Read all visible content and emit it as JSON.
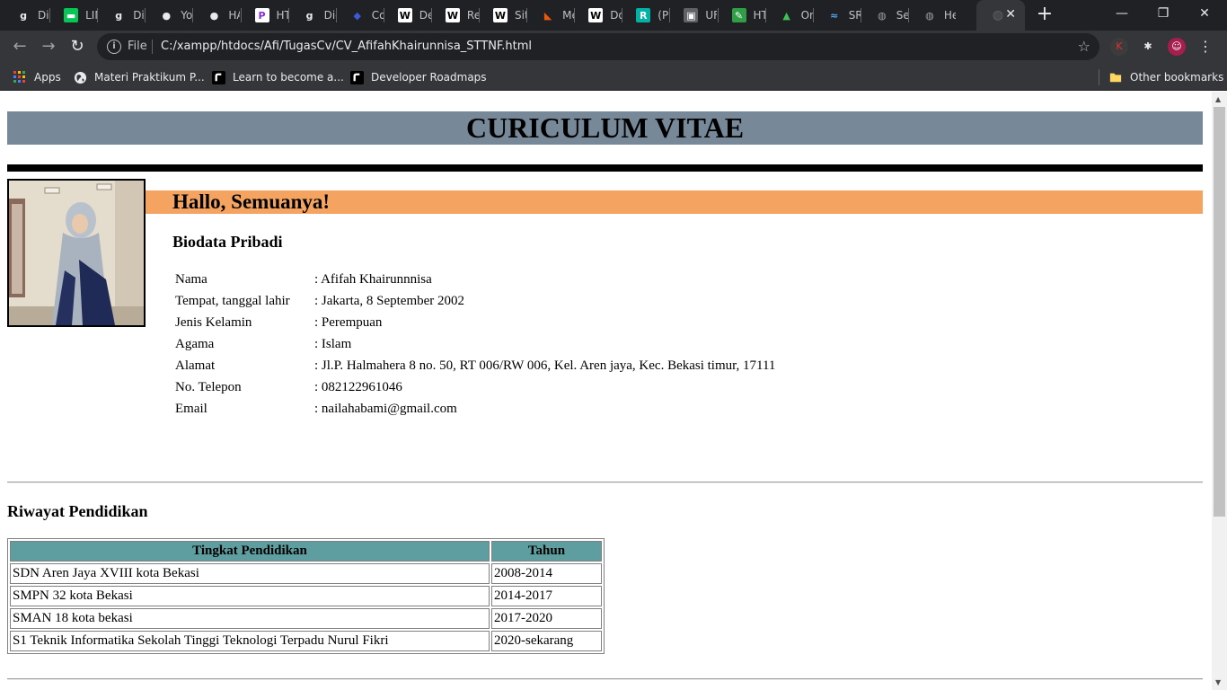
{
  "browser": {
    "tabs": [
      {
        "title": "Dic",
        "icon": "letter-g-icon",
        "icon_glyph": "g",
        "icon_color": "#e8eaed",
        "icon_bg": "transparent"
      },
      {
        "title": "LIN",
        "icon": "line-icon",
        "icon_glyph": "▬",
        "icon_color": "#ffffff",
        "icon_bg": "#06c755"
      },
      {
        "title": "Dic",
        "icon": "letter-g-icon",
        "icon_glyph": "g",
        "icon_color": "#e8eaed",
        "icon_bg": "transparent"
      },
      {
        "title": "Yo",
        "icon": "github-icon",
        "icon_glyph": "●",
        "icon_color": "#e8eaed",
        "icon_bg": "transparent"
      },
      {
        "title": "HA",
        "icon": "github-icon",
        "icon_glyph": "●",
        "icon_color": "#e8eaed",
        "icon_bg": "transparent"
      },
      {
        "title": "HT",
        "icon": "p-logo-icon",
        "icon_glyph": "P",
        "icon_color": "#8a2be2",
        "icon_bg": "#ffffff"
      },
      {
        "title": "Dic",
        "icon": "letter-g-icon",
        "icon_glyph": "g",
        "icon_color": "#e8eaed",
        "icon_bg": "transparent"
      },
      {
        "title": "Co",
        "icon": "blue-blob-icon",
        "icon_glyph": "◆",
        "icon_color": "#3b5bdb",
        "icon_bg": "transparent"
      },
      {
        "title": "De",
        "icon": "wikipedia-icon",
        "icon_glyph": "W",
        "icon_color": "#000000",
        "icon_bg": "#ffffff"
      },
      {
        "title": "Re",
        "icon": "wikipedia-icon",
        "icon_glyph": "W",
        "icon_color": "#000000",
        "icon_bg": "#ffffff"
      },
      {
        "title": "Sit",
        "icon": "wikipedia-icon",
        "icon_glyph": "W",
        "icon_color": "#000000",
        "icon_bg": "#ffffff"
      },
      {
        "title": "Me",
        "icon": "red-flag-icon",
        "icon_glyph": "◣",
        "icon_color": "#e8590c",
        "icon_bg": "transparent"
      },
      {
        "title": "Do",
        "icon": "wikipedia-icon",
        "icon_glyph": "W",
        "icon_color": "#000000",
        "icon_bg": "#ffffff"
      },
      {
        "title": "(PI",
        "icon": "r-logo-icon",
        "icon_glyph": "R",
        "icon_color": "#ffffff",
        "icon_bg": "#00b3a4"
      },
      {
        "title": "UF",
        "icon": "store-icon",
        "icon_glyph": "▣",
        "icon_color": "#ffffff",
        "icon_bg": "#5f6368"
      },
      {
        "title": "HT",
        "icon": "code-icon",
        "icon_glyph": "✎",
        "icon_color": "#ffffff",
        "icon_bg": "#2f9e44"
      },
      {
        "title": "Or",
        "icon": "green-mark-icon",
        "icon_glyph": "▲",
        "icon_color": "#40c057",
        "icon_bg": "transparent"
      },
      {
        "title": "SR",
        "icon": "wave-icon",
        "icon_glyph": "≈",
        "icon_color": "#4dabf7",
        "icon_bg": "transparent"
      },
      {
        "title": "Sel",
        "icon": "globe-icon",
        "icon_glyph": "◍",
        "icon_color": "#9aa0a6",
        "icon_bg": "transparent"
      },
      {
        "title": "He",
        "icon": "globe-icon",
        "icon_glyph": "◍",
        "icon_color": "#9aa0a6",
        "icon_bg": "transparent"
      }
    ],
    "active_tab": {
      "title": "",
      "icon": "globe-icon",
      "close": "✕"
    },
    "new_tab": "+",
    "window_controls": {
      "minimize": "—",
      "restore": "❐",
      "close": "✕"
    },
    "omnibox": {
      "scheme_label": "File",
      "url": "C:/xampp/htdocs/Afi/TugasCv/CV_AfifahKhairunnisa_STTNF.html"
    },
    "extensions": [
      {
        "icon": "k-extension-icon",
        "glyph": "K",
        "color": "#e03131",
        "bg": "#3c3c3c"
      },
      {
        "icon": "puzzle-icon",
        "glyph": "✱",
        "color": "#e8eaed",
        "bg": "transparent"
      },
      {
        "icon": "profile-avatar-icon",
        "glyph": "☺",
        "color": "#ffffff",
        "bg": "#a61e4d"
      },
      {
        "icon": "kebab-menu-icon",
        "glyph": "⋮",
        "color": "#e8eaed",
        "bg": "transparent"
      }
    ],
    "bookmarks": [
      {
        "label": "Apps",
        "icon": "apps-grid-icon"
      },
      {
        "label": "Materi Praktikum P...",
        "icon": "globe-icon"
      },
      {
        "label": "Learn to become a...",
        "icon": "roadmap-icon"
      },
      {
        "label": "Developer Roadmaps",
        "icon": "roadmap-icon"
      }
    ],
    "other_bookmarks": "Other bookmarks"
  },
  "colors": {
    "header_bg": "#778899",
    "greeting_bg": "#f4a460",
    "table_header_bg": "#5f9ea0"
  },
  "cv": {
    "title": "CURICULUM VITAE",
    "greeting": "Hallo, Semuanya!",
    "biodata_title": "Biodata Pribadi",
    "biodata": [
      {
        "label": "Nama",
        "value": ": Afifah Khairunnnisa"
      },
      {
        "label": "Tempat, tanggal lahir",
        "value": ": Jakarta, 8 September 2002"
      },
      {
        "label": "Jenis Kelamin",
        "value": ": Perempuan"
      },
      {
        "label": "Agama",
        "value": ": Islam"
      },
      {
        "label": "Alamat",
        "value": ": Jl.P. Halmahera 8 no. 50, RT 006/RW 006, Kel. Aren jaya, Kec. Bekasi timur, 17111"
      },
      {
        "label": "No. Telepon",
        "value": ": 082122961046"
      },
      {
        "label": "Email",
        "value": ": nailahabami@gmail.com"
      }
    ],
    "education_title": "Riwayat Pendidikan",
    "education_headers": [
      "Tingkat Pendidikan",
      "Tahun"
    ],
    "education_rows": [
      [
        "SDN Aren Jaya XVIII kota Bekasi",
        "2008-2014"
      ],
      [
        "SMPN 32 kota Bekasi",
        "2014-2017"
      ],
      [
        "SMAN 18 kota bekasi",
        "2017-2020"
      ],
      [
        "S1 Teknik Informatika Sekolah Tinggi Teknologi Terpadu Nurul Fikri",
        "2020-sekarang"
      ]
    ]
  }
}
